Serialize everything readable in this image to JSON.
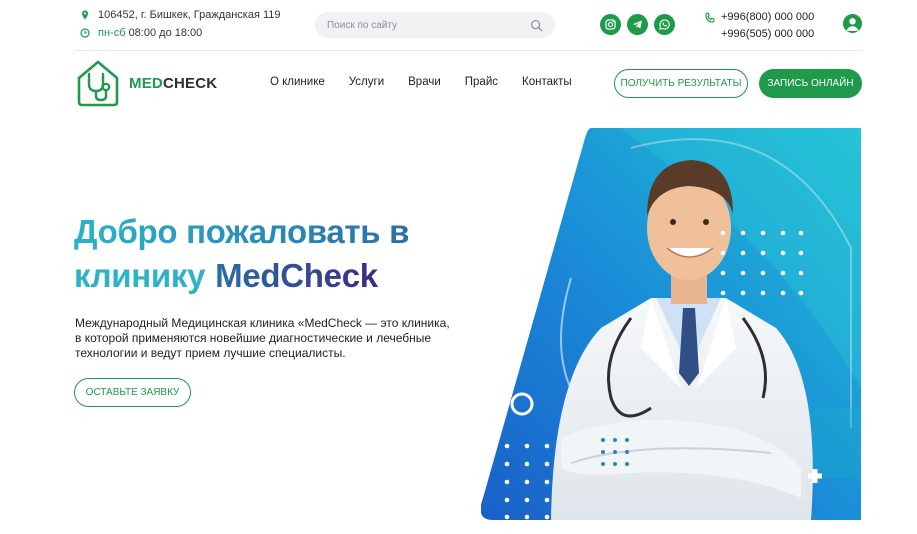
{
  "topbar": {
    "address": "106452, г. Бишкек, Гражданская 119",
    "hours_days": "пн-сб",
    "hours_time": "08:00 до 18:00",
    "search_placeholder": "Поиск по сайту",
    "socials": [
      "instagram-icon",
      "telegram-icon",
      "whatsapp-icon"
    ],
    "phone_1": "+996(800) 000 000",
    "phone_2": "+996(505) 000 000"
  },
  "logo": {
    "med": "MED",
    "check": "CHECK"
  },
  "nav": {
    "items": [
      "О клинике",
      "Услуги",
      "Врачи",
      "Прайс",
      "Контакты"
    ]
  },
  "buttons": {
    "results": "ПОЛУЧИТЬ РЕЗУЛЬТАТЫ",
    "book": "ЗАПИСЬ ОНЛАЙН",
    "request": "ОСТАВЬТЕ ЗАЯВКУ"
  },
  "hero": {
    "title_line1": "Добро пожаловать в",
    "title_line2": "клинику",
    "title_brand": "MedCheck",
    "description": "Международный Медицинская клиника «MedCheck — это клиника, в которой применяются новейшие диагностические и лечебные технологии и ведут прием лучшие специалисты."
  },
  "colors": {
    "brand_green": "#1e9a4a",
    "hero_cyan": "#2bb3c9",
    "hero_navy": "#3b2b85",
    "art_blue": "#1a7fd0"
  }
}
